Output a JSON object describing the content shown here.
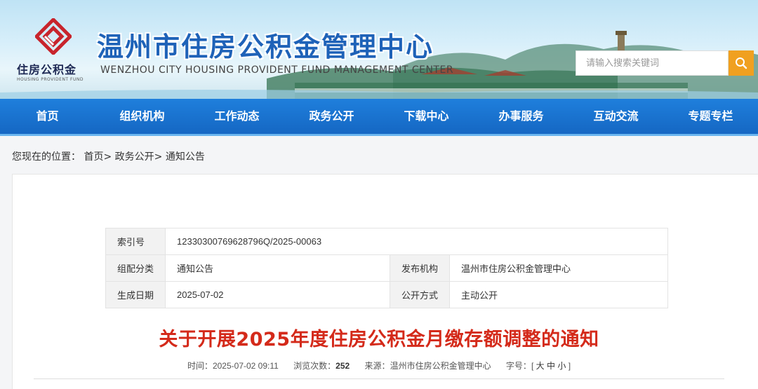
{
  "header": {
    "logo_cn": "住房公积金",
    "logo_en": "HOUSING PROVIDENT FUND",
    "title": "温州市住房公积金管理中心",
    "subtitle": "WENZHOU CITY HOUSING PROVIDENT FUND MANAGEMENT CENTER",
    "search_placeholder": "请输入搜索关键词",
    "search_icon": "search-icon"
  },
  "nav": {
    "items": [
      "首页",
      "组织机构",
      "工作动态",
      "政务公开",
      "下载中心",
      "办事服务",
      "互动交流",
      "专题专栏"
    ]
  },
  "breadcrumb": {
    "prefix": "您现在的位置：",
    "items": [
      "首页>",
      "政务公开>",
      "通知公告"
    ]
  },
  "meta_table": {
    "index_label": "索引号",
    "index_value": "12330300769628796Q/2025-00063",
    "category_label": "组配分类",
    "category_value": "通知公告",
    "publisher_label": "发布机构",
    "publisher_value": "温州市住房公积金管理中心",
    "date_label": "生成日期",
    "date_value": "2025-07-02",
    "disclosure_label": "公开方式",
    "disclosure_value": "主动公开"
  },
  "article": {
    "title": "关于开展2025年度住房公积金月缴存额调整的通知",
    "time_label": "时间：",
    "time_value": "2025-07-02 09:11",
    "views_label": "浏览次数：",
    "views_value": "252",
    "source_label": "来源：",
    "source_value": "温州市住房公积金管理中心",
    "fontsize_label": "字号：",
    "fontsize_open": "[",
    "fontsize_large": "大",
    "fontsize_medium": "中",
    "fontsize_small": "小",
    "fontsize_close": "]"
  },
  "colors": {
    "nav_blue": "#1a6fcf",
    "title_blue": "#1e62b8",
    "headline_red": "#d42a1a",
    "search_orange": "#f0a020"
  }
}
